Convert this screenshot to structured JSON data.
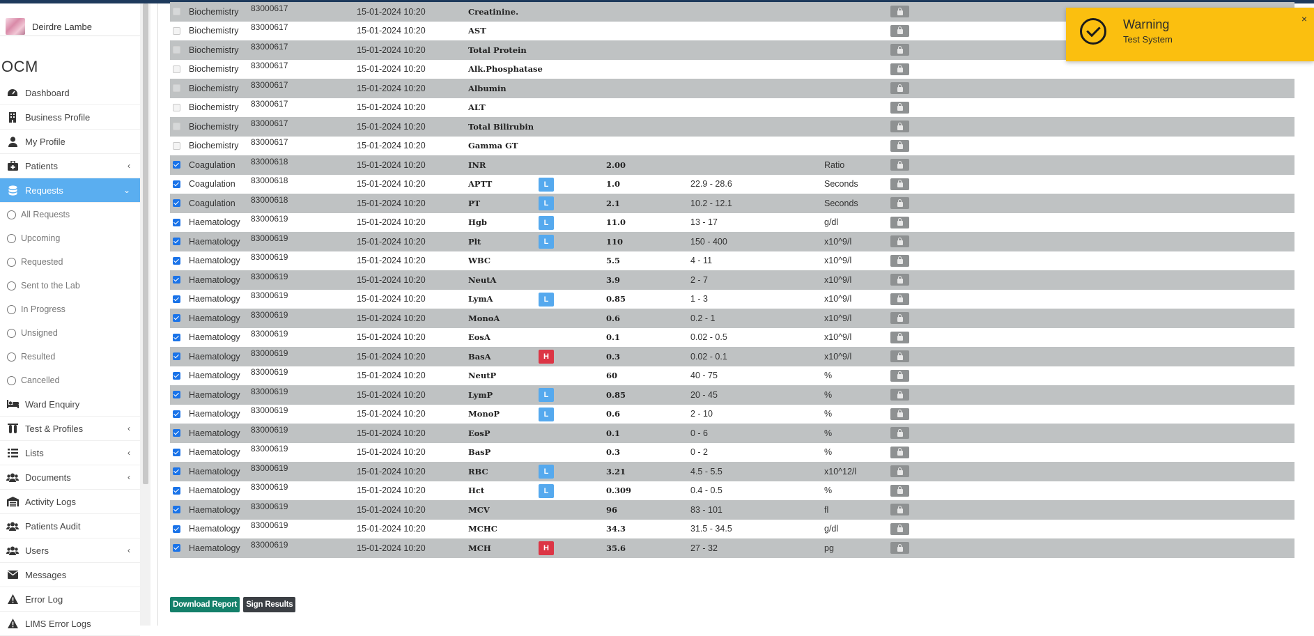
{
  "user": {
    "name": "Deirdre Lambe"
  },
  "brand": "OCM",
  "nav": [
    {
      "label": "Dashboard",
      "icon": "dashboard-icon"
    },
    {
      "label": "Business Profile",
      "icon": "building-icon"
    },
    {
      "label": "My Profile",
      "icon": "user-icon"
    },
    {
      "label": "Patients",
      "icon": "patients-icon",
      "chevron": "‹"
    },
    {
      "label": "Requests",
      "icon": "database-icon",
      "chevron": "⌄",
      "active": true
    },
    {
      "label": "Ward Enquiry",
      "icon": "bed-icon"
    },
    {
      "label": "Test & Profiles",
      "icon": "flask-icon",
      "chevron": "‹"
    },
    {
      "label": "Lists",
      "icon": "list-icon",
      "chevron": "‹"
    },
    {
      "label": "Documents",
      "icon": "users-icon",
      "chevron": "‹"
    },
    {
      "label": "Activity Logs",
      "icon": "warehouse-icon"
    },
    {
      "label": "Patients Audit",
      "icon": "users-icon"
    },
    {
      "label": "Users",
      "icon": "users-icon",
      "chevron": "‹"
    },
    {
      "label": "Messages",
      "icon": "envelope-icon"
    },
    {
      "label": "Error Log",
      "icon": "warning-icon"
    },
    {
      "label": "LIMS Error Logs",
      "icon": "warning-icon"
    }
  ],
  "requests_sub": [
    "All Requests",
    "Upcoming",
    "Requested",
    "Sent to the Lab",
    "In Progress",
    "Unsigned",
    "Resulted",
    "Cancelled"
  ],
  "rows": [
    {
      "checked": false,
      "dept": "Biochemistry",
      "id": "83000617",
      "date": "15-01-2024 10:20",
      "test": "Creatinine.",
      "flag": "",
      "value": "",
      "range": "",
      "unit": ""
    },
    {
      "checked": false,
      "dept": "Biochemistry",
      "id": "83000617",
      "date": "15-01-2024 10:20",
      "test": "AST",
      "flag": "",
      "value": "",
      "range": "",
      "unit": ""
    },
    {
      "checked": false,
      "dept": "Biochemistry",
      "id": "83000617",
      "date": "15-01-2024 10:20",
      "test": "Total Protein",
      "flag": "",
      "value": "",
      "range": "",
      "unit": ""
    },
    {
      "checked": false,
      "dept": "Biochemistry",
      "id": "83000617",
      "date": "15-01-2024 10:20",
      "test": "Alk.Phosphatase",
      "flag": "",
      "value": "",
      "range": "",
      "unit": ""
    },
    {
      "checked": false,
      "dept": "Biochemistry",
      "id": "83000617",
      "date": "15-01-2024 10:20",
      "test": "Albumin",
      "flag": "",
      "value": "",
      "range": "",
      "unit": ""
    },
    {
      "checked": false,
      "dept": "Biochemistry",
      "id": "83000617",
      "date": "15-01-2024 10:20",
      "test": "ALT",
      "flag": "",
      "value": "",
      "range": "",
      "unit": ""
    },
    {
      "checked": false,
      "dept": "Biochemistry",
      "id": "83000617",
      "date": "15-01-2024 10:20",
      "test": "Total Bilirubin",
      "flag": "",
      "value": "",
      "range": "",
      "unit": ""
    },
    {
      "checked": false,
      "dept": "Biochemistry",
      "id": "83000617",
      "date": "15-01-2024 10:20",
      "test": "Gamma GT",
      "flag": "",
      "value": "",
      "range": "",
      "unit": ""
    },
    {
      "checked": true,
      "dept": "Coagulation",
      "id": "83000618",
      "date": "15-01-2024 10:20",
      "test": "INR",
      "flag": "",
      "value": "2.00",
      "range": "",
      "unit": "Ratio"
    },
    {
      "checked": true,
      "dept": "Coagulation",
      "id": "83000618",
      "date": "15-01-2024 10:20",
      "test": "APTT",
      "flag": "L",
      "value": "1.0",
      "range": "22.9 - 28.6",
      "unit": "Seconds"
    },
    {
      "checked": true,
      "dept": "Coagulation",
      "id": "83000618",
      "date": "15-01-2024 10:20",
      "test": "PT",
      "flag": "L",
      "value": "2.1",
      "range": "10.2 - 12.1",
      "unit": "Seconds"
    },
    {
      "checked": true,
      "dept": "Haematology",
      "id": "83000619",
      "date": "15-01-2024 10:20",
      "test": "Hgb",
      "flag": "L",
      "value": "11.0",
      "range": "13 - 17",
      "unit": "g/dl"
    },
    {
      "checked": true,
      "dept": "Haematology",
      "id": "83000619",
      "date": "15-01-2024 10:20",
      "test": "Plt",
      "flag": "L",
      "value": "110",
      "range": "150 - 400",
      "unit": "x10^9/l"
    },
    {
      "checked": true,
      "dept": "Haematology",
      "id": "83000619",
      "date": "15-01-2024 10:20",
      "test": "WBC",
      "flag": "",
      "value": "5.5",
      "range": "4 - 11",
      "unit": "x10^9/l"
    },
    {
      "checked": true,
      "dept": "Haematology",
      "id": "83000619",
      "date": "15-01-2024 10:20",
      "test": "NeutA",
      "flag": "",
      "value": "3.9",
      "range": "2 - 7",
      "unit": "x10^9/l"
    },
    {
      "checked": true,
      "dept": "Haematology",
      "id": "83000619",
      "date": "15-01-2024 10:20",
      "test": "LymA",
      "flag": "L",
      "value": "0.85",
      "range": "1 - 3",
      "unit": "x10^9/l"
    },
    {
      "checked": true,
      "dept": "Haematology",
      "id": "83000619",
      "date": "15-01-2024 10:20",
      "test": "MonoA",
      "flag": "",
      "value": "0.6",
      "range": "0.2 - 1",
      "unit": "x10^9/l"
    },
    {
      "checked": true,
      "dept": "Haematology",
      "id": "83000619",
      "date": "15-01-2024 10:20",
      "test": "EosA",
      "flag": "",
      "value": "0.1",
      "range": "0.02 - 0.5",
      "unit": "x10^9/l"
    },
    {
      "checked": true,
      "dept": "Haematology",
      "id": "83000619",
      "date": "15-01-2024 10:20",
      "test": "BasA",
      "flag": "H",
      "value": "0.3",
      "range": "0.02 - 0.1",
      "unit": "x10^9/l"
    },
    {
      "checked": true,
      "dept": "Haematology",
      "id": "83000619",
      "date": "15-01-2024 10:20",
      "test": "NeutP",
      "flag": "",
      "value": "60",
      "range": "40 - 75",
      "unit": "%"
    },
    {
      "checked": true,
      "dept": "Haematology",
      "id": "83000619",
      "date": "15-01-2024 10:20",
      "test": "LymP",
      "flag": "L",
      "value": "0.85",
      "range": "20 - 45",
      "unit": "%"
    },
    {
      "checked": true,
      "dept": "Haematology",
      "id": "83000619",
      "date": "15-01-2024 10:20",
      "test": "MonoP",
      "flag": "L",
      "value": "0.6",
      "range": "2 - 10",
      "unit": "%"
    },
    {
      "checked": true,
      "dept": "Haematology",
      "id": "83000619",
      "date": "15-01-2024 10:20",
      "test": "EosP",
      "flag": "",
      "value": "0.1",
      "range": "0 - 6",
      "unit": "%"
    },
    {
      "checked": true,
      "dept": "Haematology",
      "id": "83000619",
      "date": "15-01-2024 10:20",
      "test": "BasP",
      "flag": "",
      "value": "0.3",
      "range": "0 - 2",
      "unit": "%"
    },
    {
      "checked": true,
      "dept": "Haematology",
      "id": "83000619",
      "date": "15-01-2024 10:20",
      "test": "RBC",
      "flag": "L",
      "value": "3.21",
      "range": "4.5 - 5.5",
      "unit": "x10^12/l"
    },
    {
      "checked": true,
      "dept": "Haematology",
      "id": "83000619",
      "date": "15-01-2024 10:20",
      "test": "Hct",
      "flag": "L",
      "value": "0.309",
      "range": "0.4 - 0.5",
      "unit": "%"
    },
    {
      "checked": true,
      "dept": "Haematology",
      "id": "83000619",
      "date": "15-01-2024 10:20",
      "test": "MCV",
      "flag": "",
      "value": "96",
      "range": "83 - 101",
      "unit": "fl"
    },
    {
      "checked": true,
      "dept": "Haematology",
      "id": "83000619",
      "date": "15-01-2024 10:20",
      "test": "MCHC",
      "flag": "",
      "value": "34.3",
      "range": "31.5 - 34.5",
      "unit": "g/dl"
    },
    {
      "checked": true,
      "dept": "Haematology",
      "id": "83000619",
      "date": "15-01-2024 10:20",
      "test": "MCH",
      "flag": "H",
      "value": "35.6",
      "range": "27 - 32",
      "unit": "pg"
    }
  ],
  "buttons": {
    "download": "Download Report",
    "sign": "Sign Results"
  },
  "toast": {
    "title": "Warning",
    "message": "Test System",
    "close": "×"
  },
  "colors": {
    "active_nav": "#5aaef0",
    "flag_low": "#55a9ee",
    "flag_high": "#dc3545",
    "toast_bg": "#fbbf0f",
    "download_btn": "#14806a",
    "sign_btn": "#3b3f44",
    "row_alt": "#bfc2c3"
  }
}
